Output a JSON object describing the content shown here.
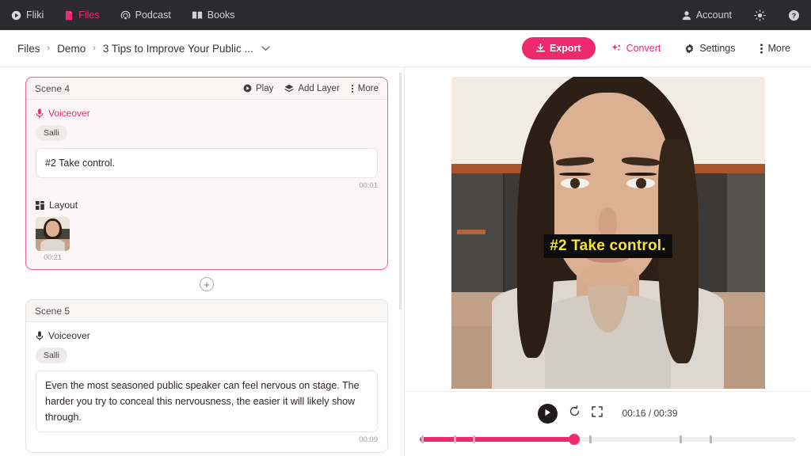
{
  "topnav": {
    "items": [
      {
        "label": "Fliki",
        "icon": "fliki-logo-icon",
        "active": false
      },
      {
        "label": "Files",
        "icon": "file-icon",
        "active": true
      },
      {
        "label": "Podcast",
        "icon": "podcast-icon",
        "active": false
      },
      {
        "label": "Books",
        "icon": "book-icon",
        "active": false
      }
    ],
    "account_label": "Account",
    "theme_icon": "sun-icon",
    "help_icon": "help-circle-icon",
    "bg_color": "#2b2b2d",
    "accent_color": "#ee2a6e"
  },
  "breadcrumb": {
    "crumbs": [
      "Files",
      "Demo",
      "3 Tips to Improve Your Public ..."
    ],
    "separator": "›",
    "caret_icon": "chevron-down-icon"
  },
  "toolbar": {
    "export_label": "Export",
    "convert_label": "Convert",
    "settings_label": "Settings",
    "more_label": "More"
  },
  "scenes": [
    {
      "title": "Scene 4",
      "selected": true,
      "actions": {
        "play": "Play",
        "add_layer": "Add Layer",
        "more": "More"
      },
      "voiceover_label": "Voiceover",
      "voice_name": "Salli",
      "script": "#2 Take control.",
      "duration": "00:01",
      "layout_label": "Layout",
      "layout_clip_duration": "00:21"
    },
    {
      "title": "Scene 5",
      "selected": false,
      "voiceover_label": "Voiceover",
      "voice_name": "Salli",
      "script": "Even the most seasoned public speaker can feel nervous on stage. The harder you try to conceal this nervousness, the easier it will likely show through.",
      "duration": "00:09"
    }
  ],
  "add_scene": {
    "icon": "plus-circle-icon"
  },
  "preview": {
    "caption_text": "#2 Take control.",
    "caption_color": "#f6e531",
    "caption_bg": "#0c0c0c"
  },
  "player": {
    "play_icon": "play-icon",
    "replay_icon": "replay-icon",
    "fullscreen_icon": "fullscreen-icon",
    "current_time": "00:16",
    "total_time": "00:39",
    "timecode": "00:16 / 00:39",
    "progress_percent": 41,
    "markers_percent": [
      0.5,
      9,
      14,
      45,
      69,
      77
    ],
    "accent_color": "#ee2a6e"
  }
}
